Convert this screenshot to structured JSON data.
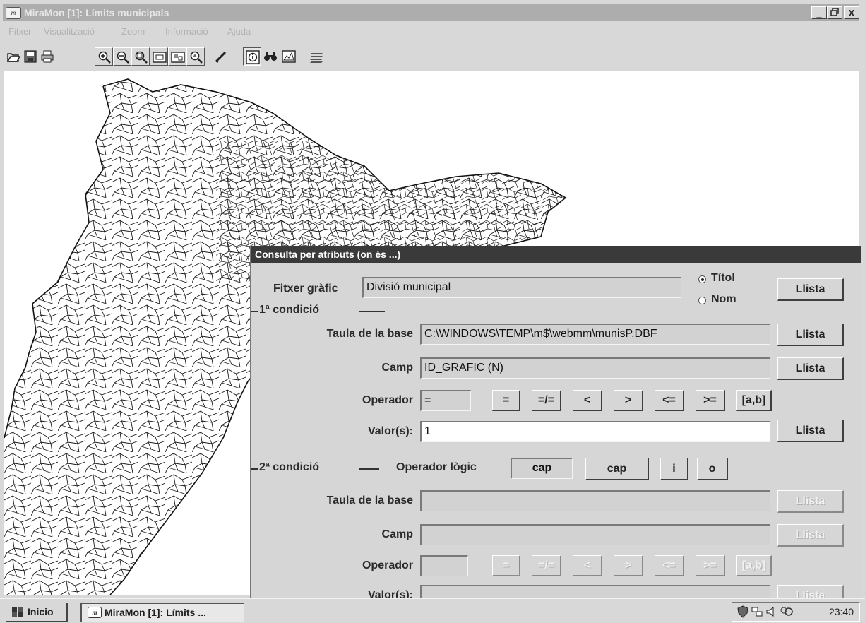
{
  "window": {
    "title": "MiraMon [1]:  Límits municipals",
    "app_icon": "m",
    "controls": {
      "minimize": "_",
      "maximize": "🗗",
      "close": "X"
    }
  },
  "menu": [
    "Fitxer",
    "Visualització",
    "Zoom",
    "Informació",
    "Ajuda"
  ],
  "toolbar": {
    "icons": [
      "open-folder-icon",
      "save-icon",
      "print-icon",
      "zoom-in-icon",
      "zoom-out-icon",
      "zoom-window-icon",
      "zoom-extent-icon",
      "zoom-previous-icon",
      "zoom-scale-icon",
      "edit-pen-icon",
      "info-icon",
      "binoculars-icon",
      "query-icon",
      "layers-icon"
    ],
    "pressed": "info-icon"
  },
  "dialog": {
    "title": "Consulta per atributs (on és ...)",
    "graphic_file": {
      "label": "Fitxer gràfic",
      "value": "Divisió municipal",
      "radio_title": "Títol",
      "radio_name": "Nom",
      "selected": "Títol",
      "button": "Llista"
    },
    "condition1": {
      "heading": "1ª condició",
      "table_label": "Taula de la base",
      "table_value": "C:\\WINDOWS\\TEMP\\m$\\webmm\\munisP.DBF",
      "table_button": "Llista",
      "field_label": "Camp",
      "field_value": "ID_GRAFIC (N)",
      "field_button": "Llista",
      "operator_label": "Operador",
      "operator_value": "=",
      "operators": [
        "=",
        "=/=",
        "<",
        ">",
        "<=",
        ">=",
        "[a,b]"
      ],
      "values_label": "Valor(s):",
      "values_value": "1",
      "values_button": "Llista"
    },
    "condition2": {
      "heading": "2ª condició",
      "logic_label": "Operador lògic",
      "logic_value": "cap",
      "logic_buttons": [
        "cap",
        "i",
        "o"
      ],
      "table_label": "Taula de la base",
      "table_value": "",
      "table_button": "Llista",
      "field_label": "Camp",
      "field_value": "",
      "field_button": "Llista",
      "operator_label": "Operador",
      "operator_value": "",
      "operators": [
        "=",
        "=/=",
        "<",
        ">",
        "<=",
        ">=",
        "[a,b]"
      ],
      "values_label": "Valor(s):",
      "values_value": "",
      "values_button": "Llista"
    }
  },
  "taskbar": {
    "start": "Inicio",
    "task": "MiraMon [1]:  Límits ...",
    "clock": "23:40"
  },
  "colors": {
    "titlebar": "#adadad",
    "dialog_titlebar": "#3a3a3a",
    "face": "#d6d6d6",
    "map_background": "#ffffff",
    "boundaries": "#111111"
  }
}
